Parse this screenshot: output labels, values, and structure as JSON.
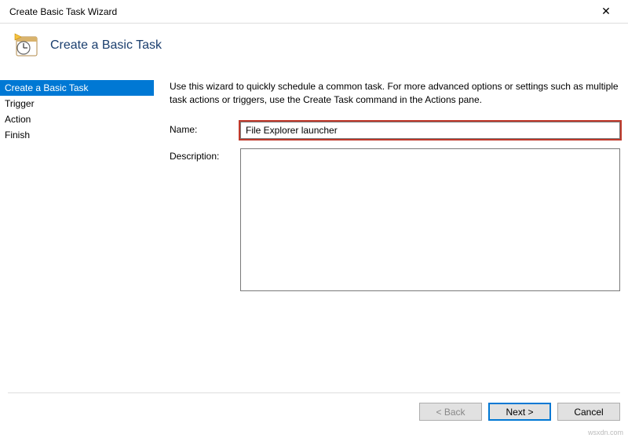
{
  "window": {
    "title": "Create Basic Task Wizard",
    "close_symbol": "✕"
  },
  "header": {
    "title": "Create a Basic Task"
  },
  "sidebar": {
    "items": [
      {
        "label": "Create a Basic Task",
        "selected": true
      },
      {
        "label": "Trigger",
        "selected": false
      },
      {
        "label": "Action",
        "selected": false
      },
      {
        "label": "Finish",
        "selected": false
      }
    ]
  },
  "main": {
    "intro": "Use this wizard to quickly schedule a common task.  For more advanced options or settings such as multiple task actions or triggers, use the Create Task command in the Actions pane.",
    "name_label": "Name:",
    "name_value": "File Explorer launcher",
    "description_label": "Description:",
    "description_value": ""
  },
  "buttons": {
    "back": "< Back",
    "next": "Next >",
    "cancel": "Cancel"
  },
  "watermark": "wsxdn.com"
}
